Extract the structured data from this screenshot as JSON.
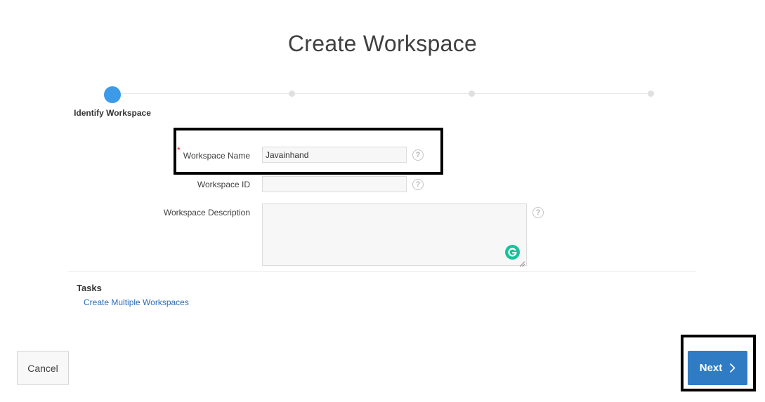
{
  "page": {
    "title": "Create Workspace"
  },
  "wizard": {
    "steps": [
      {
        "label": "Identify Workspace",
        "state": "active"
      },
      {
        "label": "",
        "state": "pending"
      },
      {
        "label": "",
        "state": "pending"
      },
      {
        "label": "",
        "state": "pending"
      }
    ],
    "active_color": "#3c9ae8"
  },
  "form": {
    "workspace_name": {
      "label": "Workspace Name",
      "required_marker": "*",
      "value": "Javainhand",
      "help_icon": "help-circle-icon"
    },
    "workspace_id": {
      "label": "Workspace ID",
      "value": "",
      "help_icon": "help-circle-icon"
    },
    "workspace_description": {
      "label": "Workspace Description",
      "value": "",
      "help_icon": "help-circle-icon",
      "extension_icon": "grammarly-icon"
    },
    "help_glyph": "?"
  },
  "tasks": {
    "heading": "Tasks",
    "links": [
      {
        "label": "Create Multiple Workspaces"
      }
    ]
  },
  "footer": {
    "cancel_label": "Cancel",
    "next_label": "Next",
    "next_icon": "chevron-right-icon",
    "next_color": "#2f7bc4"
  },
  "annotations": {
    "highlight_color": "#000000"
  }
}
